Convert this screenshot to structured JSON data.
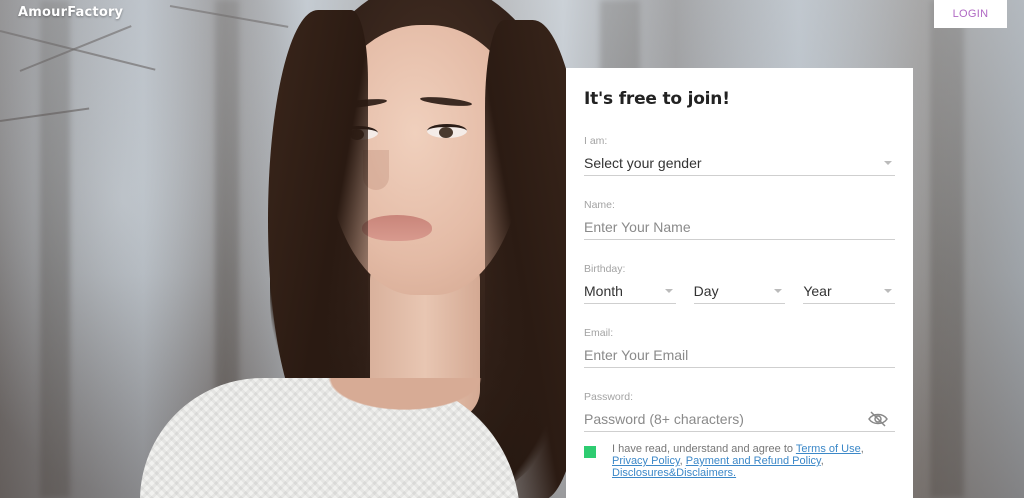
{
  "brand": {
    "logo_text": "AmourFactory"
  },
  "header": {
    "login_label": "LOGIN"
  },
  "signup": {
    "title": "It's free to join!",
    "gender": {
      "label": "I am:",
      "value": "Select your gender"
    },
    "name": {
      "label": "Name:",
      "placeholder": "Enter Your Name"
    },
    "birthday": {
      "label": "Birthday:",
      "month": "Month",
      "day": "Day",
      "year": "Year"
    },
    "email": {
      "label": "Email:",
      "placeholder": "Enter Your Email"
    },
    "password": {
      "label": "Password:",
      "placeholder": "Password (8+ characters)",
      "toggle_icon": "eye-slash-icon"
    },
    "agreement": {
      "checked": true,
      "prefix": "I have read, understand and agree to ",
      "terms": "Terms of Use",
      "sep1": ", ",
      "privacy": "Privacy Policy",
      "sep2": ", ",
      "refund": "Payment and Refund Policy",
      "sep3": ", ",
      "disclosures": "Disclosures&Disclaimers."
    }
  },
  "colors": {
    "accent": "#b069c4",
    "checkbox": "#2ecc71",
    "link": "#3c88c8"
  }
}
